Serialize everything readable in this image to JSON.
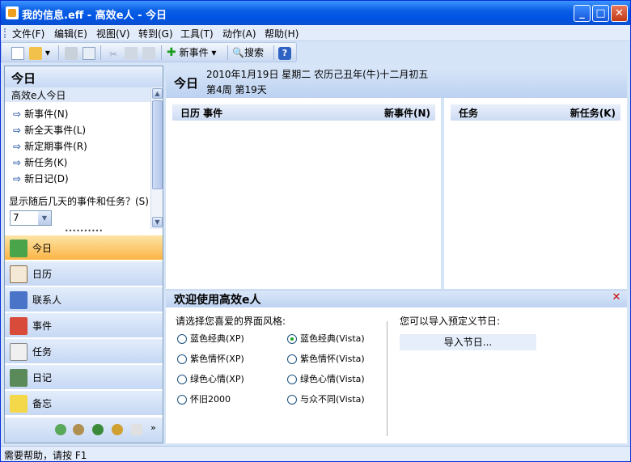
{
  "window": {
    "title": "我的信息.eff - 高效e人 - 今日",
    "min": "_",
    "max": "□",
    "close": "✕"
  },
  "menu": [
    "文件(F)",
    "编辑(E)",
    "视图(V)",
    "转到(G)",
    "工具(T)",
    "动作(A)",
    "帮助(H)"
  ],
  "toolbar": {
    "new_event": "新事件",
    "search": "搜索"
  },
  "left": {
    "header": "今日",
    "sub": "高效e人今日",
    "links": [
      "新事件(N)",
      "新全天事件(L)",
      "新定期事件(R)",
      "新任务(K)",
      "新日记(D)"
    ],
    "days_label": "显示随后几天的事件和任务？(S)",
    "days_value": "7",
    "nav": [
      "今日",
      "日历",
      "联系人",
      "事件",
      "任务",
      "日记",
      "备忘"
    ]
  },
  "right": {
    "title": "今日",
    "date": "2010年1月19日 星期二 农历己丑年(牛)十二月初五",
    "week": "第4周 第19天",
    "cal_head": "日历 事件",
    "cal_new": "新事件(N)",
    "task_head": "任务",
    "task_new": "新任务(K)"
  },
  "welcome": {
    "title": "欢迎使用高效e人",
    "prompt": "请选择您喜爱的界面风格:",
    "options": [
      {
        "label": "蓝色经典(XP)",
        "selected": false
      },
      {
        "label": "蓝色经典(Vista)",
        "selected": true
      },
      {
        "label": "紫色情怀(XP)",
        "selected": false
      },
      {
        "label": "紫色情怀(Vista)",
        "selected": false
      },
      {
        "label": "绿色心情(XP)",
        "selected": false
      },
      {
        "label": "绿色心情(Vista)",
        "selected": false
      },
      {
        "label": "怀旧2000",
        "selected": false
      },
      {
        "label": "与众不同(Vista)",
        "selected": false
      }
    ],
    "import_prompt": "您可以导入预定义节日:",
    "import_button": "导入节日..."
  },
  "status": "需要帮助，请按 F1"
}
